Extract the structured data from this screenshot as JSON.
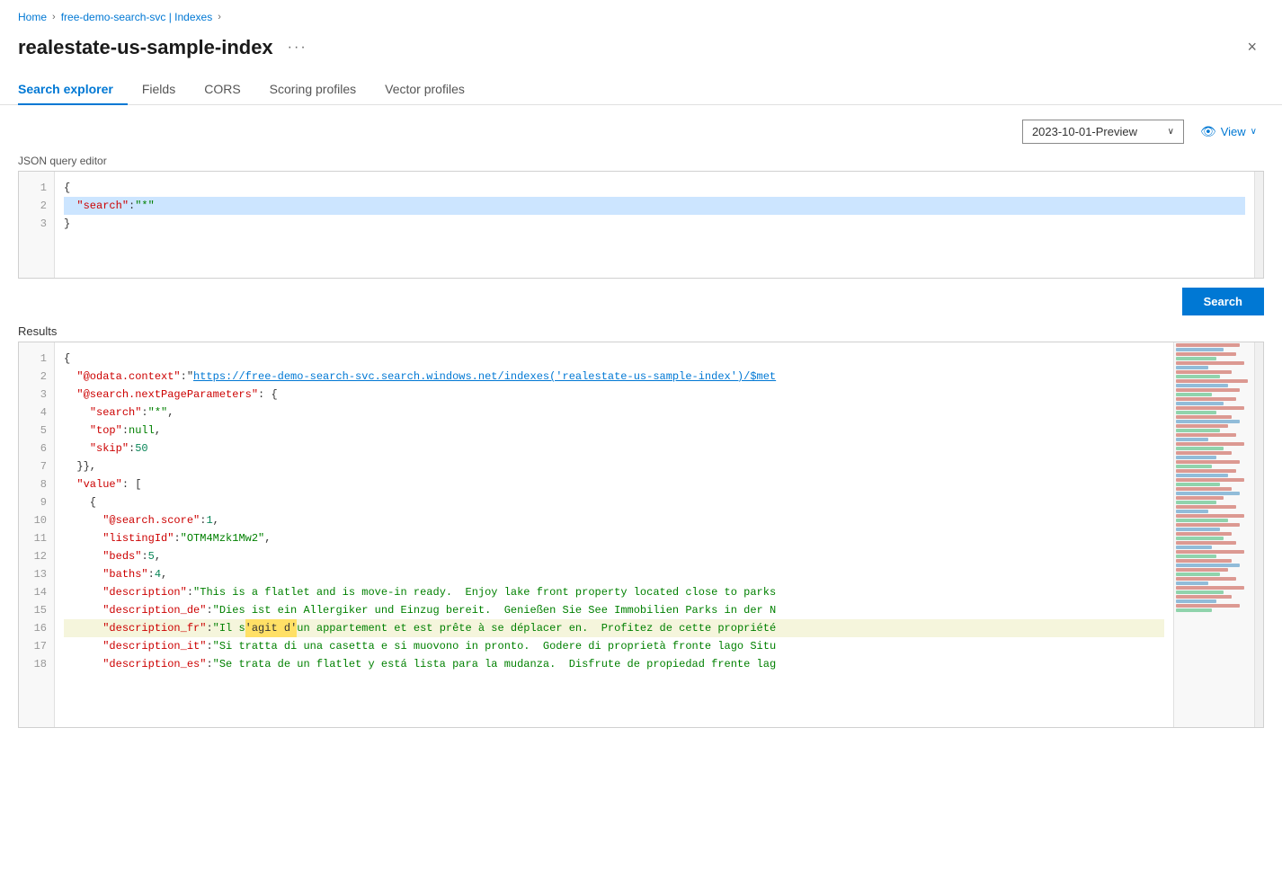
{
  "breadcrumb": {
    "home": "Home",
    "service": "free-demo-search-svc | Indexes",
    "current": ""
  },
  "page": {
    "title": "realestate-us-sample-index",
    "ellipsis": "···",
    "close": "×"
  },
  "tabs": [
    {
      "id": "search-explorer",
      "label": "Search explorer",
      "active": true
    },
    {
      "id": "fields",
      "label": "Fields",
      "active": false
    },
    {
      "id": "cors",
      "label": "CORS",
      "active": false
    },
    {
      "id": "scoring-profiles",
      "label": "Scoring profiles",
      "active": false
    },
    {
      "id": "vector-profiles",
      "label": "Vector profiles",
      "active": false
    }
  ],
  "toolbar": {
    "api_version_label": "2023-10-01-Preview",
    "view_label": "View",
    "dropdown_arrow": "∨"
  },
  "editor": {
    "label": "JSON query editor",
    "lines": [
      {
        "num": 1,
        "text": "{"
      },
      {
        "num": 2,
        "text": "  \"search\": \"*\"",
        "highlighted": true
      },
      {
        "num": 3,
        "text": "}"
      }
    ]
  },
  "search_button": "Search",
  "results": {
    "label": "Results",
    "lines": [
      {
        "num": 1,
        "text": "{"
      },
      {
        "num": 2,
        "text": "  \"@odata.context\": \"https://free-demo-search-svc.search.windows.net/indexes('realestate-us-sample-index')/$met",
        "link_part": "https://free-demo-search-svc.search.windows.net/indexes('realestate-us-sample-index')/$met"
      },
      {
        "num": 3,
        "text": "  \"@search.nextPageParameters\": {"
      },
      {
        "num": 4,
        "text": "    \"search\": \"*\","
      },
      {
        "num": 5,
        "text": "    \"top\": null,"
      },
      {
        "num": 6,
        "text": "    \"skip\": 50"
      },
      {
        "num": 7,
        "text": "  },"
      },
      {
        "num": 8,
        "text": "  \"value\": ["
      },
      {
        "num": 9,
        "text": "    {"
      },
      {
        "num": 10,
        "text": "      \"@search.score\": 1,"
      },
      {
        "num": 11,
        "text": "      \"listingId\": \"OTM4Mzk1Mw2\","
      },
      {
        "num": 12,
        "text": "      \"beds\": 5,"
      },
      {
        "num": 13,
        "text": "      \"baths\": 4,"
      },
      {
        "num": 14,
        "text": "      \"description\": \"This is a flatlet and is move-in ready.  Enjoy lake front property located close to parks"
      },
      {
        "num": 15,
        "text": "      \"description_de\": \"Dies ist ein Allergiker und Einzug bereit.  Genießen Sie See Immobilien Parks in der N"
      },
      {
        "num": 16,
        "text": "      \"description_fr\": \"Il s'agit d'un appartement et est prête à se déplacer en.  Profitez de cette propriété",
        "has_highlight": true
      },
      {
        "num": 17,
        "text": "      \"description_it\": \"Si tratta di una casetta e si muovono in pronto.  Godere di proprietà fronte lago Situ"
      },
      {
        "num": 18,
        "text": "      \"description_es\": \"Se trata de un flatlet y está lista para la mudanza.  Disfrute de propiedad frente lag"
      }
    ]
  },
  "minimap": {
    "stripes": [
      {
        "color": "#c0392b",
        "width": "80%"
      },
      {
        "color": "#2980b9",
        "width": "60%"
      },
      {
        "color": "#c0392b",
        "width": "75%"
      },
      {
        "color": "#27ae60",
        "width": "50%"
      },
      {
        "color": "#c0392b",
        "width": "85%"
      },
      {
        "color": "#2980b9",
        "width": "40%"
      },
      {
        "color": "#c0392b",
        "width": "70%"
      },
      {
        "color": "#27ae60",
        "width": "55%"
      },
      {
        "color": "#c0392b",
        "width": "90%"
      },
      {
        "color": "#2980b9",
        "width": "65%"
      },
      {
        "color": "#c0392b",
        "width": "80%"
      },
      {
        "color": "#27ae60",
        "width": "45%"
      },
      {
        "color": "#c0392b",
        "width": "75%"
      },
      {
        "color": "#2980b9",
        "width": "60%"
      },
      {
        "color": "#c0392b",
        "width": "85%"
      },
      {
        "color": "#27ae60",
        "width": "50%"
      },
      {
        "color": "#c0392b",
        "width": "70%"
      },
      {
        "color": "#2980b9",
        "width": "80%"
      },
      {
        "color": "#c0392b",
        "width": "65%"
      },
      {
        "color": "#27ae60",
        "width": "55%"
      },
      {
        "color": "#c0392b",
        "width": "75%"
      },
      {
        "color": "#2980b9",
        "width": "40%"
      },
      {
        "color": "#c0392b",
        "width": "85%"
      },
      {
        "color": "#27ae60",
        "width": "60%"
      },
      {
        "color": "#c0392b",
        "width": "70%"
      },
      {
        "color": "#2980b9",
        "width": "50%"
      },
      {
        "color": "#c0392b",
        "width": "80%"
      },
      {
        "color": "#27ae60",
        "width": "45%"
      },
      {
        "color": "#c0392b",
        "width": "75%"
      },
      {
        "color": "#2980b9",
        "width": "65%"
      },
      {
        "color": "#c0392b",
        "width": "85%"
      },
      {
        "color": "#27ae60",
        "width": "55%"
      },
      {
        "color": "#c0392b",
        "width": "70%"
      },
      {
        "color": "#2980b9",
        "width": "80%"
      },
      {
        "color": "#c0392b",
        "width": "60%"
      },
      {
        "color": "#27ae60",
        "width": "50%"
      },
      {
        "color": "#c0392b",
        "width": "75%"
      },
      {
        "color": "#2980b9",
        "width": "40%"
      },
      {
        "color": "#c0392b",
        "width": "85%"
      },
      {
        "color": "#27ae60",
        "width": "65%"
      },
      {
        "color": "#c0392b",
        "width": "80%"
      },
      {
        "color": "#2980b9",
        "width": "55%"
      },
      {
        "color": "#c0392b",
        "width": "70%"
      },
      {
        "color": "#27ae60",
        "width": "60%"
      },
      {
        "color": "#c0392b",
        "width": "75%"
      },
      {
        "color": "#2980b9",
        "width": "45%"
      },
      {
        "color": "#c0392b",
        "width": "85%"
      },
      {
        "color": "#27ae60",
        "width": "50%"
      },
      {
        "color": "#c0392b",
        "width": "70%"
      },
      {
        "color": "#2980b9",
        "width": "80%"
      },
      {
        "color": "#c0392b",
        "width": "65%"
      },
      {
        "color": "#27ae60",
        "width": "55%"
      },
      {
        "color": "#c0392b",
        "width": "75%"
      },
      {
        "color": "#2980b9",
        "width": "40%"
      },
      {
        "color": "#c0392b",
        "width": "85%"
      },
      {
        "color": "#27ae60",
        "width": "60%"
      },
      {
        "color": "#c0392b",
        "width": "70%"
      },
      {
        "color": "#2980b9",
        "width": "50%"
      },
      {
        "color": "#c0392b",
        "width": "80%"
      },
      {
        "color": "#27ae60",
        "width": "45%"
      }
    ]
  }
}
